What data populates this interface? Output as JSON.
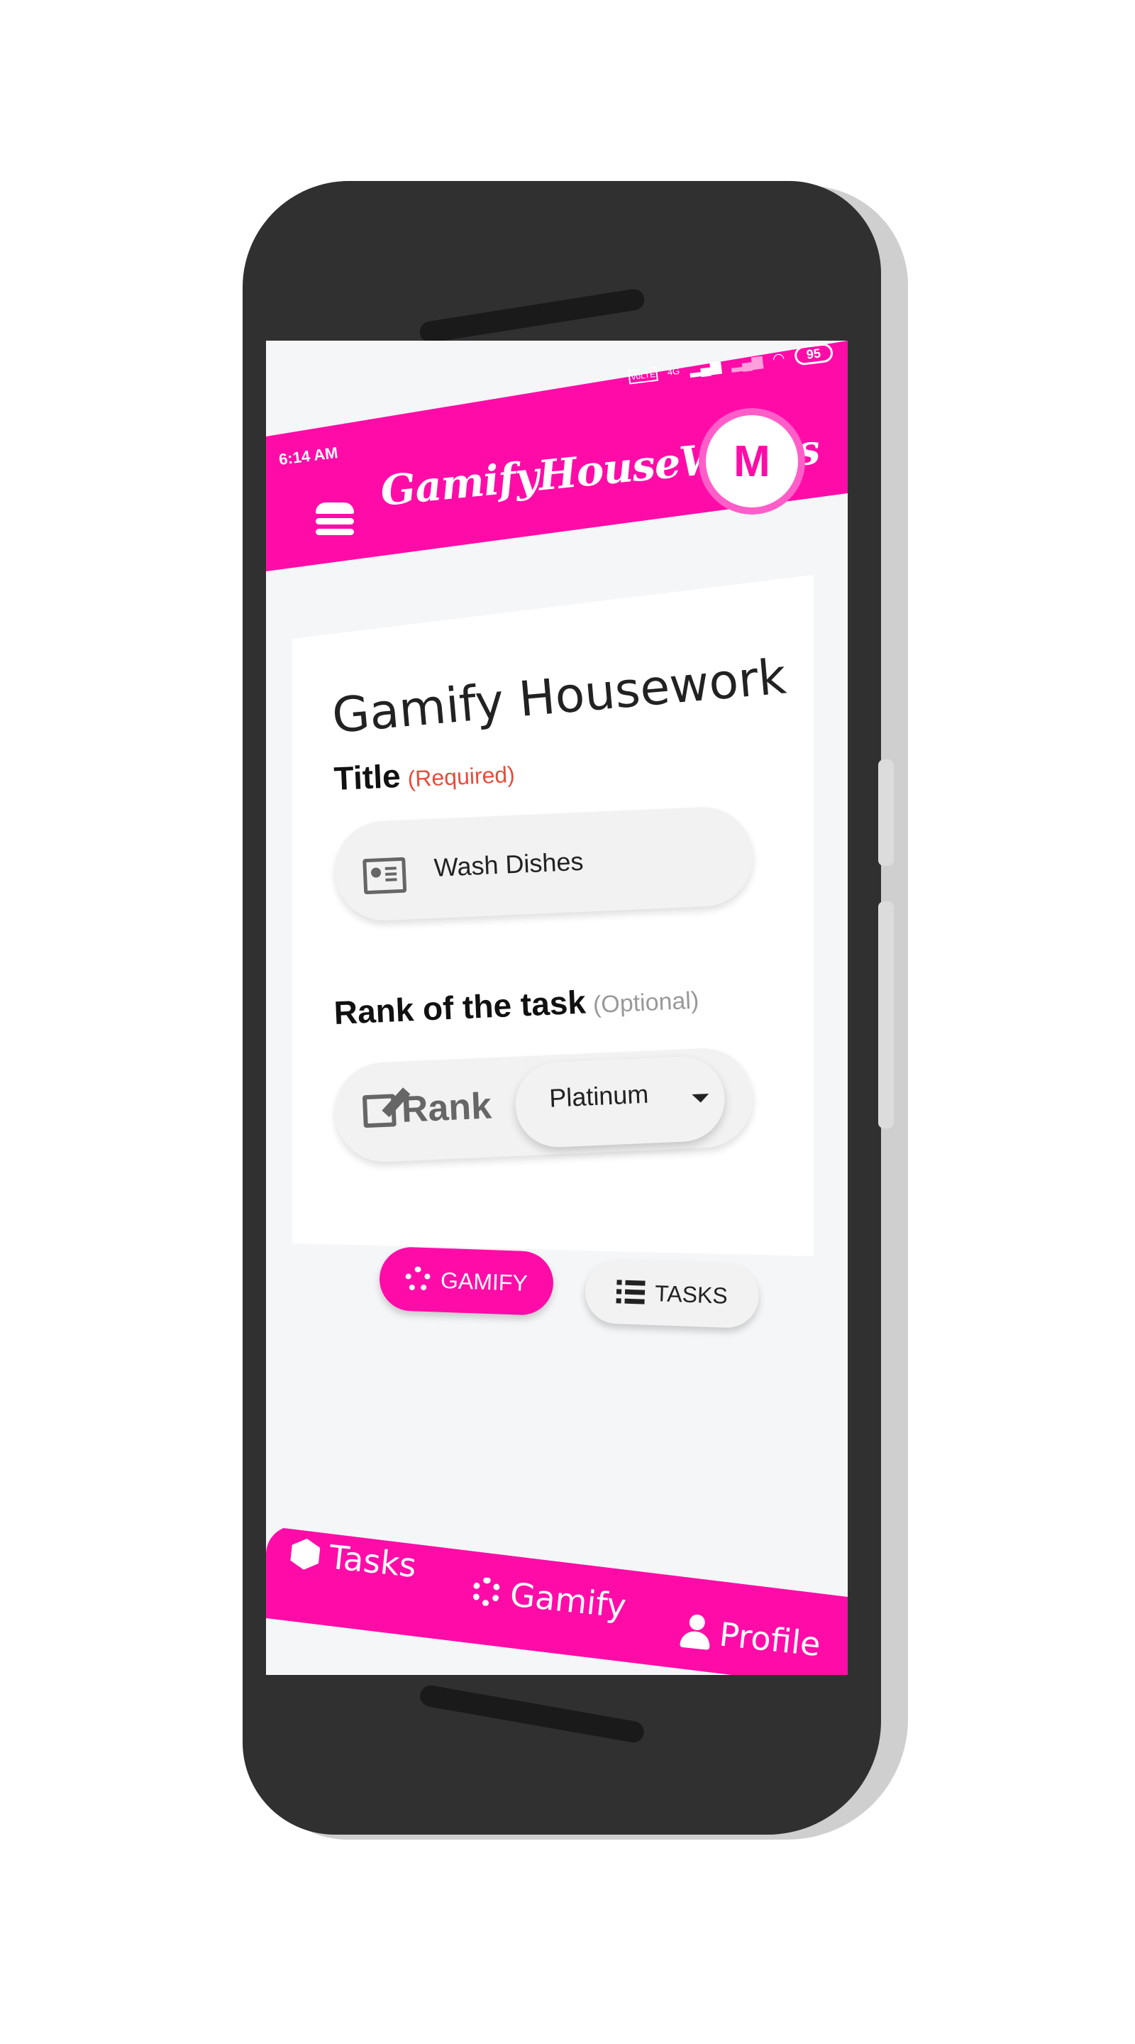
{
  "colors": {
    "accent": "#ff0ca8",
    "required": "#e74c3c",
    "optional": "#999999"
  },
  "status_bar": {
    "time": "6:14 AM",
    "network": "4G",
    "volte": "VoLTE",
    "battery": "95"
  },
  "app_bar": {
    "title": "GamifyHouseWorks",
    "avatar_letter": "M",
    "menu_icon": "hamburger-icon"
  },
  "card": {
    "heading": "Gamify Housework",
    "title_field": {
      "label": "Title",
      "hint": "(Required)",
      "value": "Wash Dishes",
      "icon": "id-card-icon"
    },
    "rank_field": {
      "label": "Rank of the task",
      "hint": "(Optional)",
      "prefix": "Rank",
      "prefix_icon": "edit-icon",
      "selected": "Platinum"
    },
    "buttons": {
      "gamify": "GAMIFY",
      "tasks": "TASKS"
    }
  },
  "bottom_nav": [
    {
      "label": "Tasks",
      "icon": "d20-icon"
    },
    {
      "label": "Gamify",
      "icon": "gears-icon"
    },
    {
      "label": "Profile",
      "icon": "user-icon"
    }
  ]
}
